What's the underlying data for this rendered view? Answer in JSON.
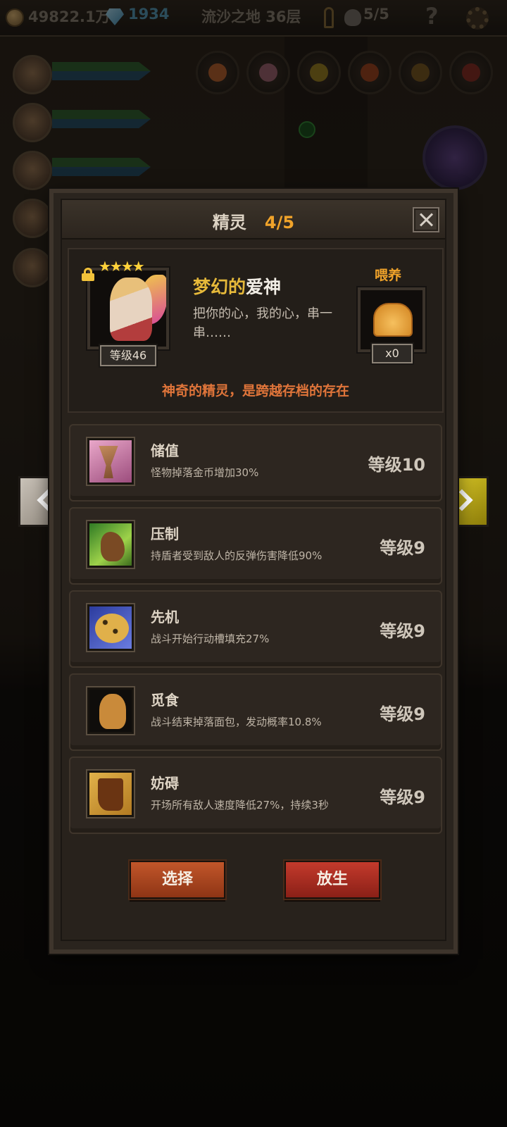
{
  "topbar": {
    "gold": "49822.1万",
    "gems": "1934",
    "location": "流沙之地 36层",
    "kills": "5/5"
  },
  "dialog": {
    "title": "精灵",
    "count": "4/5",
    "sprite": {
      "name_prefix": "梦幻的",
      "name_main": "爱神",
      "description": "把你的心，我的心，串一串……",
      "level": "等级46",
      "stars": "★★★★"
    },
    "feed": {
      "label": "喂养",
      "count": "x0"
    },
    "tagline": "神奇的精灵，是跨越存档的存在",
    "skills": [
      {
        "name": "储值",
        "desc": "怪物掉落金币增加30%",
        "level": "等级10",
        "icon": "golden-cup-icon"
      },
      {
        "name": "压制",
        "desc": "持盾者受到敌人的反弹伤害降低90%",
        "level": "等级9",
        "icon": "beast-claw-icon"
      },
      {
        "name": "先机",
        "desc": "战斗开始行动槽填充27%",
        "level": "等级9",
        "icon": "leopard-icon"
      },
      {
        "name": "觅食",
        "desc": "战斗结束掉落面包，发动概率10.8%",
        "level": "等级9",
        "icon": "gingerbread-icon"
      },
      {
        "name": "妨碍",
        "desc": "开场所有敌人速度降低27%，持续3秒",
        "level": "等级9",
        "icon": "chained-boot-icon"
      }
    ],
    "buttons": {
      "select": "选择",
      "release": "放生"
    }
  },
  "colors": {
    "accent_orange": "#f0a32a",
    "tagline_orange": "#e0753a",
    "name_gold": "#e6b93a"
  }
}
